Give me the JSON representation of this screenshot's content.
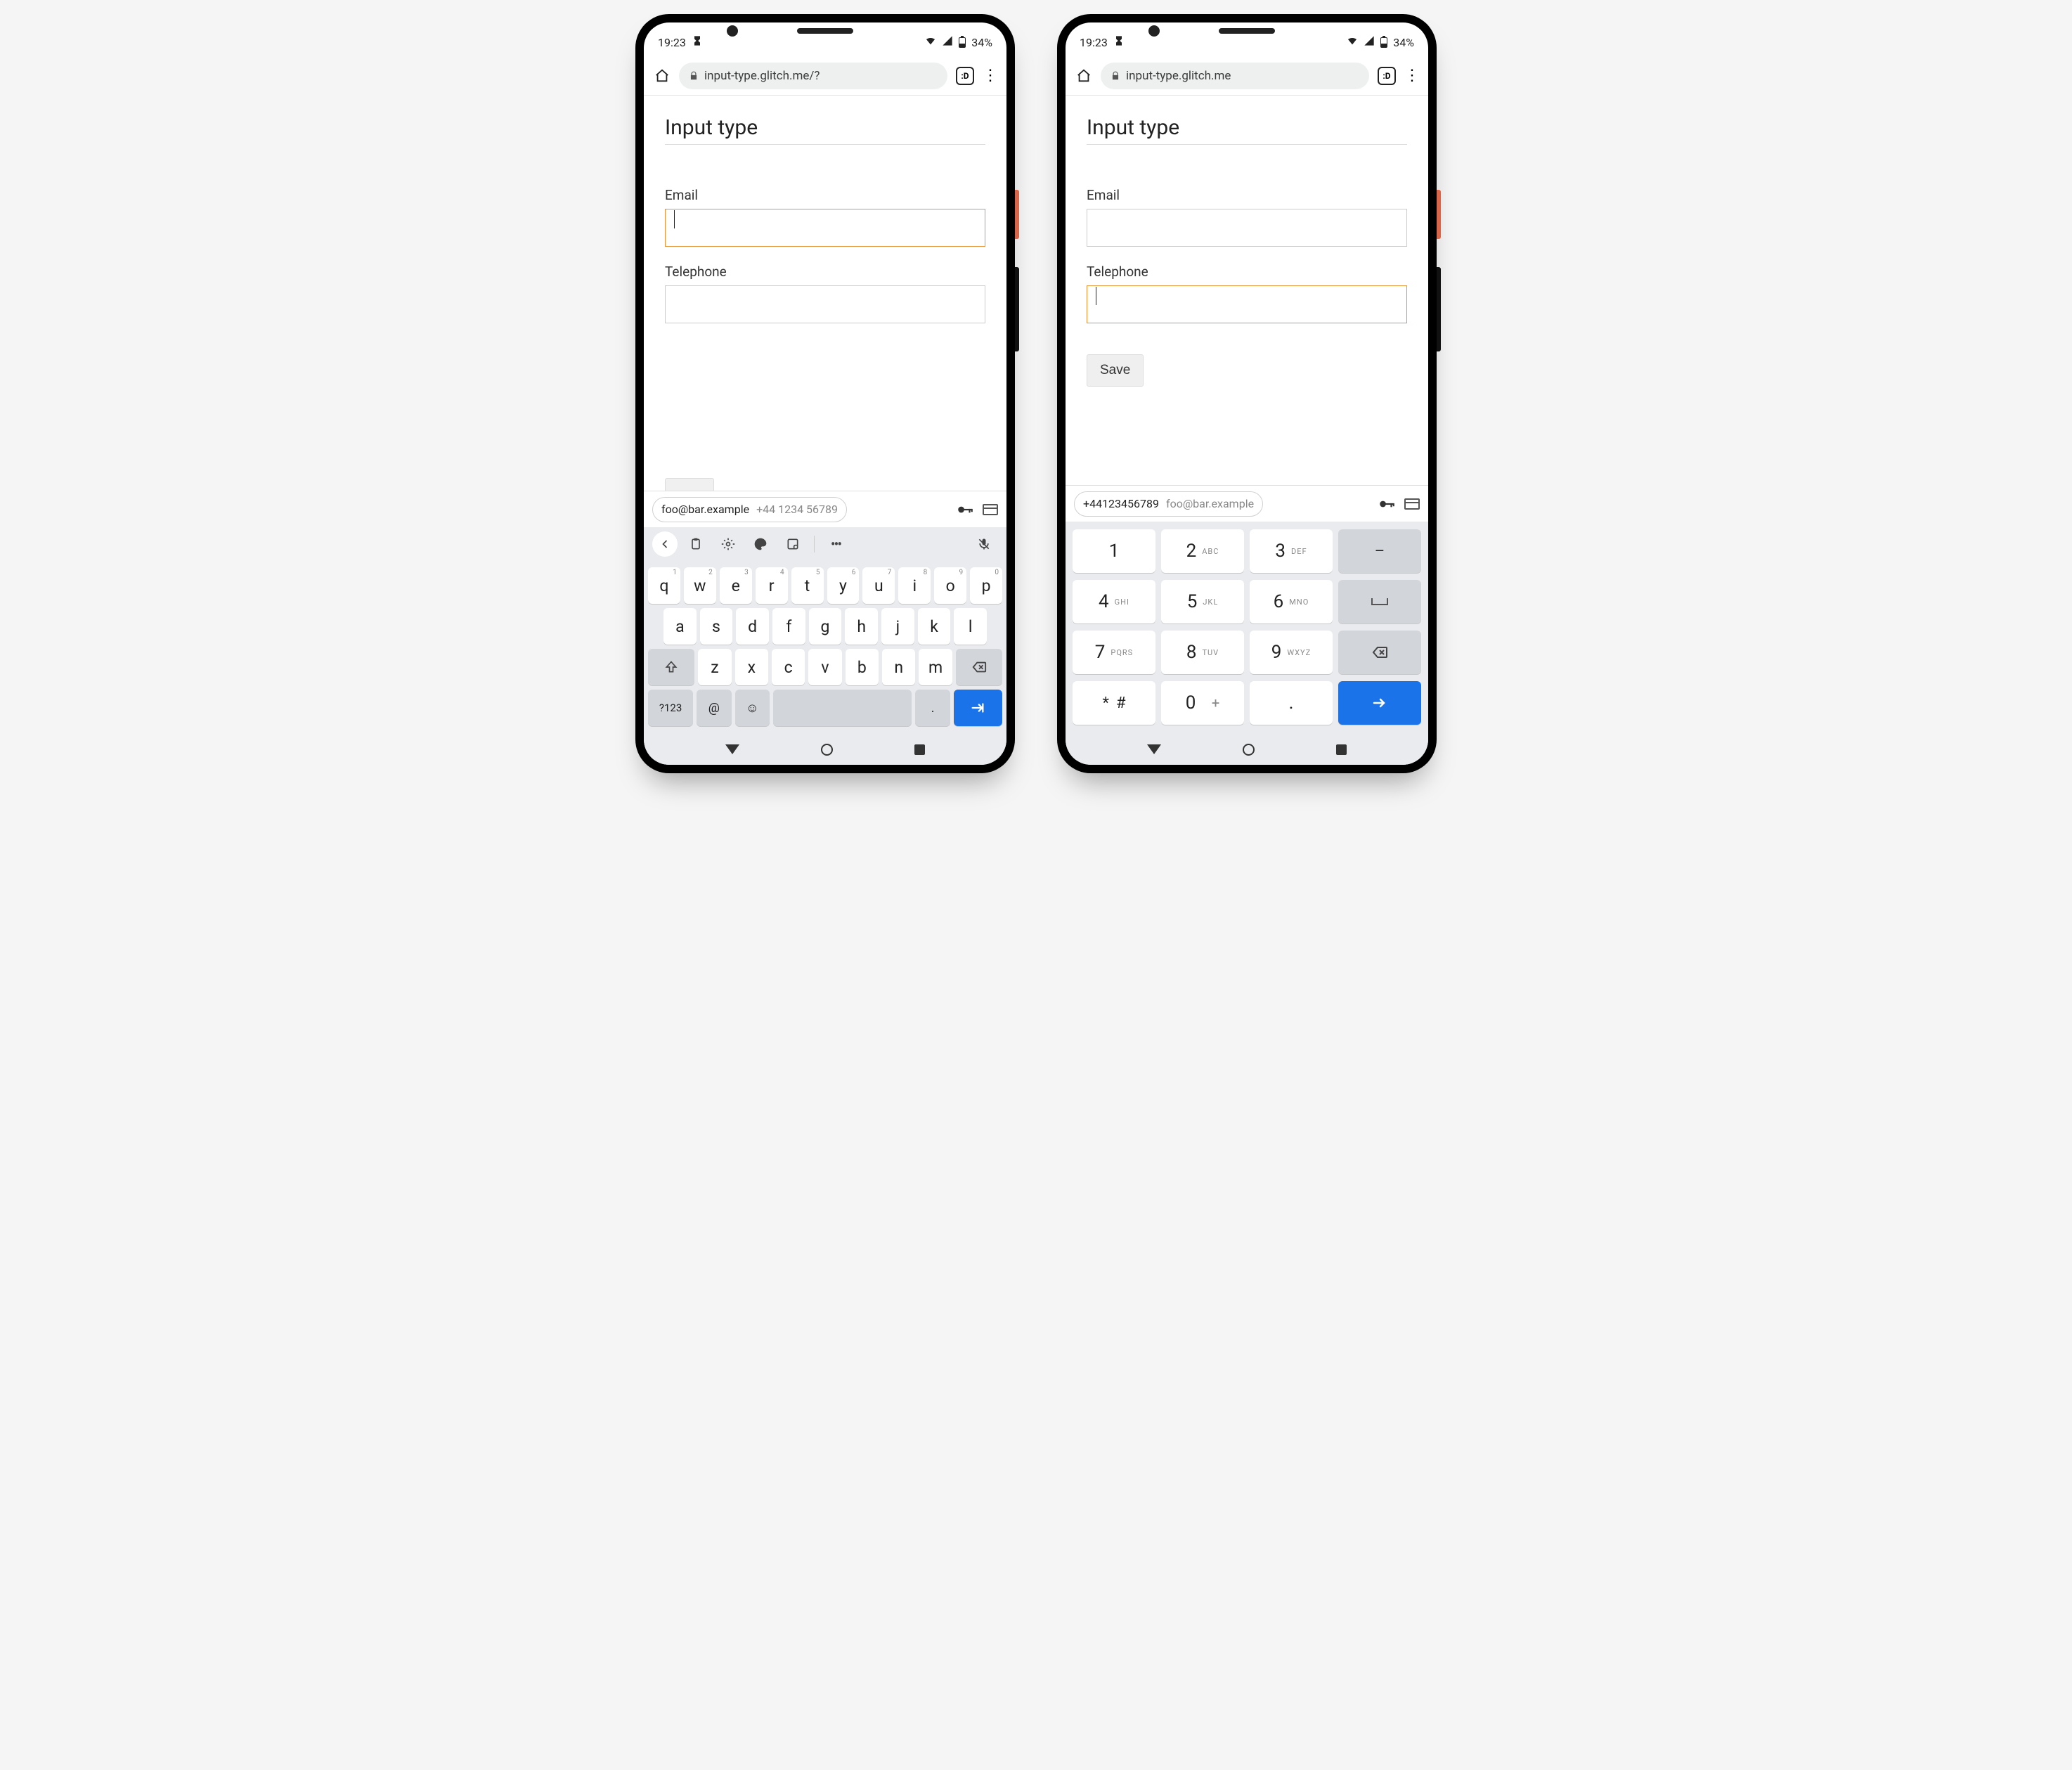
{
  "status": {
    "time": "19:23",
    "battery": "34%"
  },
  "browser": {
    "url_left": "input-type.glitch.me/?",
    "url_right": "input-type.glitch.me",
    "tab_badge": ":D"
  },
  "page": {
    "title": "Input type",
    "email_label": "Email",
    "tel_label": "Telephone",
    "save_label": "Save"
  },
  "autofill": {
    "email": "foo@bar.example",
    "phone_spaced": "+44 1234 56789",
    "phone": "+44123456789"
  },
  "qwerty": {
    "row1": [
      {
        "k": "q",
        "s": "1"
      },
      {
        "k": "w",
        "s": "2"
      },
      {
        "k": "e",
        "s": "3"
      },
      {
        "k": "r",
        "s": "4"
      },
      {
        "k": "t",
        "s": "5"
      },
      {
        "k": "y",
        "s": "6"
      },
      {
        "k": "u",
        "s": "7"
      },
      {
        "k": "i",
        "s": "8"
      },
      {
        "k": "o",
        "s": "9"
      },
      {
        "k": "p",
        "s": "0"
      }
    ],
    "row2": [
      "a",
      "s",
      "d",
      "f",
      "g",
      "h",
      "j",
      "k",
      "l"
    ],
    "row3": [
      "z",
      "x",
      "c",
      "v",
      "b",
      "n",
      "m"
    ],
    "sym_key": "?123",
    "at_key": "@",
    "period_key": "."
  },
  "dialpad": {
    "r1": [
      {
        "n": "1",
        "t": ""
      },
      {
        "n": "2",
        "t": "ABC"
      },
      {
        "n": "3",
        "t": "DEF"
      }
    ],
    "r2": [
      {
        "n": "4",
        "t": "GHI"
      },
      {
        "n": "5",
        "t": "JKL"
      },
      {
        "n": "6",
        "t": "MNO"
      }
    ],
    "r3": [
      {
        "n": "7",
        "t": "PQRS"
      },
      {
        "n": "8",
        "t": "TUV"
      },
      {
        "n": "9",
        "t": "WXYZ"
      }
    ],
    "star_hash": "* #",
    "zero": "0",
    "plus": "+",
    "dash": "–",
    "period": "."
  }
}
